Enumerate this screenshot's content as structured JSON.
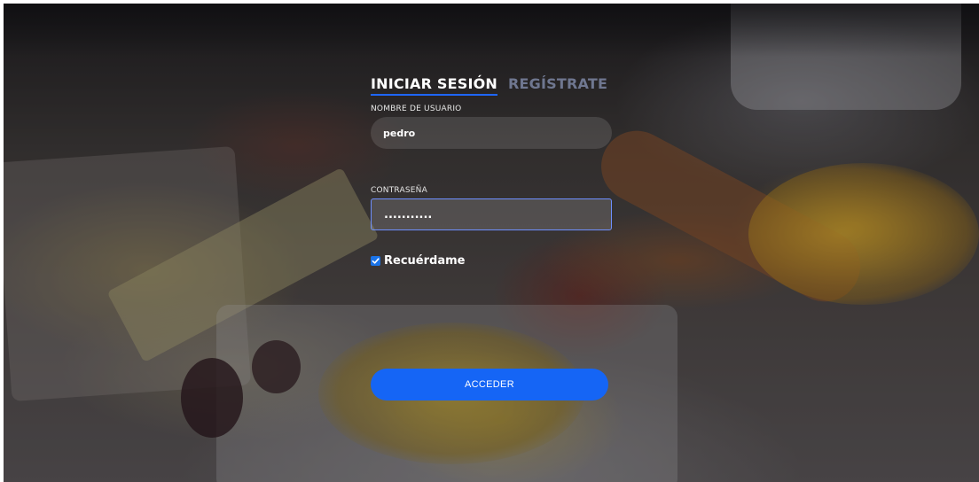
{
  "tabs": {
    "login": "INICIAR SESIÓN",
    "register": "REGÍSTRATE"
  },
  "form": {
    "username_label": "NOMBRE DE USUARIO",
    "username_value": "pedro",
    "password_label": "CONTRASEÑA",
    "password_value": "...........",
    "remember_label": "Recuérdame",
    "remember_checked": true,
    "submit_label": "ACCEDER"
  },
  "colors": {
    "accent": "#1565f5",
    "tab_inactive": "#6f7790"
  },
  "icons": {
    "checkbox": "check-icon"
  }
}
